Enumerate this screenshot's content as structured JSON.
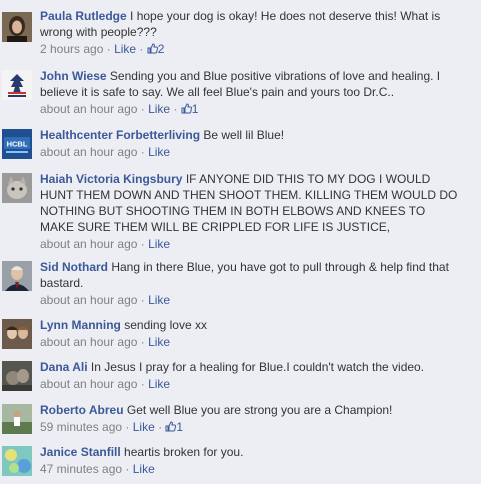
{
  "comments": [
    {
      "author": "Paula Rutledge",
      "text": "I hope your dog is okay! He does not deserve this! What is wrong with people???",
      "time": "2 hours ago",
      "like_label": "Like",
      "likes": "2"
    },
    {
      "author": "John Wiese",
      "text": "Sending you and Blue positive vibrations of love and healing. I believe it is safe to say. We all feel Blue's pain and yours too Dr.C..",
      "time": "about an hour ago",
      "like_label": "Like",
      "likes": "1"
    },
    {
      "author": "Healthcenter Forbetterliving",
      "text": "Be well lil Blue!",
      "time": "about an hour ago",
      "like_label": "Like"
    },
    {
      "author": "Haiah Victoria Kingsbury",
      "text": "IF ANYONE DID THIS TO MY DOG I WOULD HUNT THEM DOWN AND THEN SHOOT THEM. KILLING THEM WOULD DO NOTHING BUT SHOOTING THEM IN BOTH ELBOWS AND KNEES TO MAKE SURE THEM WILL BE CRIPPLED FOR LIFE IS JUSTICE,",
      "time": "about an hour ago",
      "like_label": "Like"
    },
    {
      "author": "Sid Nothard",
      "text": "Hang in there Blue, you have got to pull through & help find that bastard.",
      "time": "about an hour ago",
      "like_label": "Like"
    },
    {
      "author": "Lynn Manning",
      "text": "sending love xx",
      "time": "about an hour ago",
      "like_label": "Like"
    },
    {
      "author": "Dana Ali",
      "text": "In Jesus I pray for a healing for Blue.I couldn't watch the video.",
      "time": "about an hour ago",
      "like_label": "Like"
    },
    {
      "author": "Roberto Abreu",
      "text": "Get well Blue you are strong you are a Champion!",
      "time": "59 minutes ago",
      "like_label": "Like",
      "likes": "1"
    },
    {
      "author": "Janice Stanfill",
      "text": "heartis broken for you.",
      "time": "47 minutes ago",
      "like_label": "Like"
    }
  ],
  "avatar_logo_text": "HCBL",
  "colors": {
    "link": "#3b5998",
    "meta": "#808080",
    "text": "#333333",
    "background": "#eceef3"
  }
}
